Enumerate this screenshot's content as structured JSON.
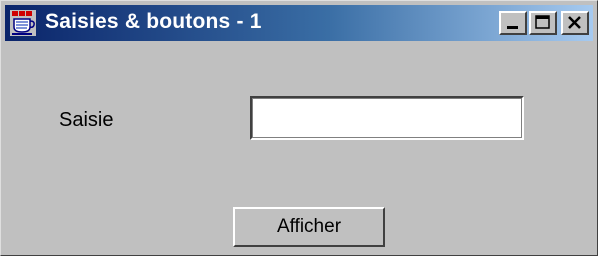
{
  "window": {
    "title": "Saisies & boutons - 1",
    "app_icon": "java-cup-icon",
    "controls": {
      "minimize_icon": "minimize-icon",
      "maximize_icon": "maximize-icon",
      "close_icon": "close-icon"
    }
  },
  "form": {
    "saisie_label": "Saisie",
    "saisie_value": "",
    "afficher_label": "Afficher"
  },
  "colors": {
    "title_bar_start": "#0a246a",
    "title_bar_end": "#a6caf0",
    "window_bg": "#c0c0c0"
  }
}
